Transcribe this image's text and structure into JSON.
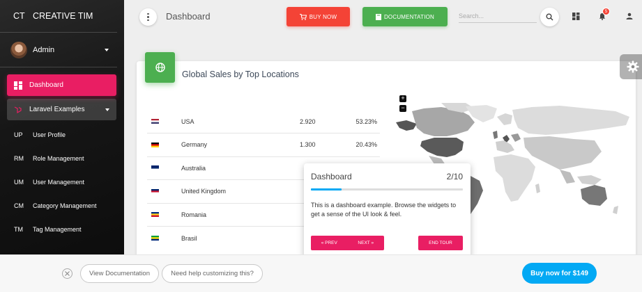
{
  "sidebar": {
    "brand_mini": "CT",
    "brand_name": "CREATIVE TIM",
    "user_name": "Admin",
    "items": [
      {
        "label": "Dashboard"
      },
      {
        "label": "Laravel Examples"
      }
    ],
    "sub_items": [
      {
        "abbr": "UP",
        "label": "User Profile"
      },
      {
        "abbr": "RM",
        "label": "Role Management"
      },
      {
        "abbr": "UM",
        "label": "User Management"
      },
      {
        "abbr": "CM",
        "label": "Category Management"
      },
      {
        "abbr": "TM",
        "label": "Tag Management"
      }
    ]
  },
  "topbar": {
    "title": "Dashboard",
    "buy_label": "BUY NOW",
    "docs_label": "DOCUMENTATION",
    "search_placeholder": "Search...",
    "notification_count": "5"
  },
  "card": {
    "title": "Global Sales by Top Locations",
    "rows": [
      {
        "country": "USA",
        "flag_colors": [
          "#b22234",
          "#ffffff",
          "#3c3b6e"
        ],
        "sales": "2.920",
        "percent": "53.23%"
      },
      {
        "country": "Germany",
        "flag_colors": [
          "#000000",
          "#dd0000",
          "#ffce00"
        ],
        "sales": "1.300",
        "percent": "20.43%"
      },
      {
        "country": "Australia",
        "flag_colors": [
          "#012169",
          "#012169",
          "#ffffff"
        ],
        "sales": "",
        "percent": ""
      },
      {
        "country": "United Kingdom",
        "flag_colors": [
          "#012169",
          "#c8102e",
          "#ffffff"
        ],
        "sales": "",
        "percent": ""
      },
      {
        "country": "Romania",
        "flag_colors": [
          "#002b7f",
          "#fcd116",
          "#ce1126"
        ],
        "sales": "",
        "percent": ""
      },
      {
        "country": "Brasil",
        "flag_colors": [
          "#009c3b",
          "#ffdf00",
          "#002776"
        ],
        "sales": "",
        "percent": ""
      }
    ],
    "zoom_in": "+",
    "zoom_out": "−"
  },
  "tour": {
    "title": "Dashboard",
    "step": "2/10",
    "progress": 0.2,
    "body": "This is a dashboard example. Browse the widgets to get a sense of the UI look & feel.",
    "prev_label": "« PREV",
    "next_label": "NEXT »",
    "end_label": "END TOUR"
  },
  "bottombar": {
    "view_docs": "View Documentation",
    "help": "Need help customizing this?",
    "buy": "Buy now for $149"
  },
  "colors": {
    "accent": "#e91e63",
    "success": "#4caf50",
    "danger": "#f44336",
    "info": "#03a9f4"
  },
  "icons": [
    "dashboard-icon",
    "laravel-icon",
    "cart-icon",
    "book-icon",
    "search-icon",
    "grid-icon",
    "bell-icon",
    "person-icon",
    "globe-icon",
    "gear-icon",
    "close-icon"
  ]
}
